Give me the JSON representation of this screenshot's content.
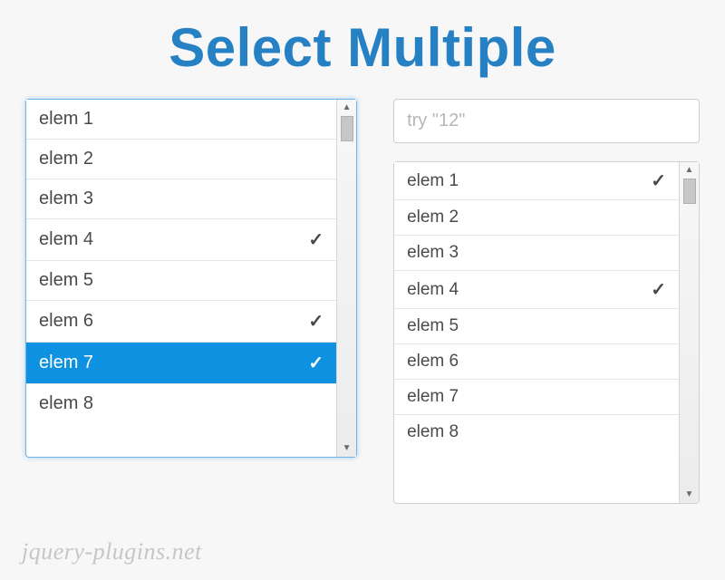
{
  "colors": {
    "accent": "#2581c4",
    "active": "#0d91e0"
  },
  "title": "Select Multiple",
  "left_list": {
    "items": [
      {
        "label": "elem 1",
        "checked": false,
        "active": false
      },
      {
        "label": "elem 2",
        "checked": false,
        "active": false
      },
      {
        "label": "elem 3",
        "checked": false,
        "active": false
      },
      {
        "label": "elem 4",
        "checked": true,
        "active": false
      },
      {
        "label": "elem 5",
        "checked": false,
        "active": false
      },
      {
        "label": "elem 6",
        "checked": true,
        "active": false
      },
      {
        "label": "elem 7",
        "checked": true,
        "active": true
      },
      {
        "label": "elem 8",
        "checked": false,
        "active": false
      }
    ]
  },
  "search": {
    "placeholder": "try \"12\""
  },
  "right_list": {
    "items": [
      {
        "label": "elem 1",
        "checked": true,
        "active": false
      },
      {
        "label": "elem 2",
        "checked": false,
        "active": false
      },
      {
        "label": "elem 3",
        "checked": false,
        "active": false
      },
      {
        "label": "elem 4",
        "checked": true,
        "active": false
      },
      {
        "label": "elem 5",
        "checked": false,
        "active": false
      },
      {
        "label": "elem 6",
        "checked": false,
        "active": false
      },
      {
        "label": "elem 7",
        "checked": false,
        "active": false
      },
      {
        "label": "elem 8",
        "checked": false,
        "active": false
      }
    ]
  },
  "watermark": "jquery-plugins.net",
  "check_glyph": "✓"
}
